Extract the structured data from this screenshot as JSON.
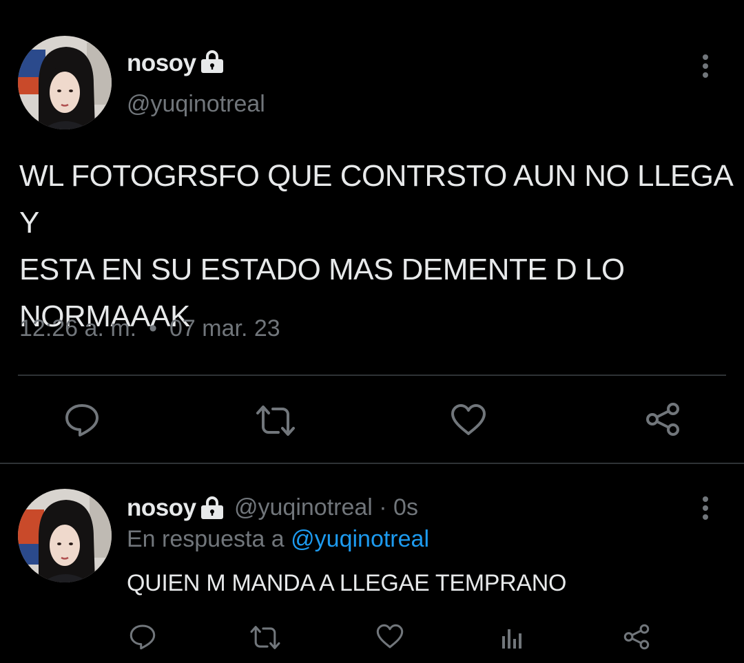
{
  "colors": {
    "background": "#000000",
    "text_primary": "#e7e9ea",
    "text_secondary": "#71767b",
    "link": "#1d9bf0",
    "divider": "#2f3336"
  },
  "main_tweet": {
    "author": {
      "name": "nosoy",
      "handle": "@yuqinotreal",
      "protected_icon": "lock-icon"
    },
    "more_icon": "more-vertical-icon",
    "text_lines": [
      "WL FOTOGRSFO QUE CONTRSTO AUN NO LLEGA Y",
      "ESTA EN SU ESTADO MAS DEMENTE D LO",
      "NORMAAAK"
    ],
    "time": "12:26 a. m.",
    "separator": "•",
    "date": "07 mar. 23",
    "actions": [
      "reply-icon",
      "retweet-icon",
      "like-icon",
      "share-icon"
    ]
  },
  "reply_tweet": {
    "author": {
      "name": "nosoy",
      "handle_time": "@yuqinotreal · 0s",
      "protected_icon": "lock-icon"
    },
    "more_icon": "more-vertical-icon",
    "reply_to_prefix": "En respuesta a",
    "reply_to_handle": "@yuqinotreal",
    "text": "QUIEN M MANDA A LLEGAE TEMPRANO",
    "actions": [
      "reply-icon",
      "retweet-icon",
      "like-icon",
      "views-icon",
      "share-icon"
    ]
  }
}
